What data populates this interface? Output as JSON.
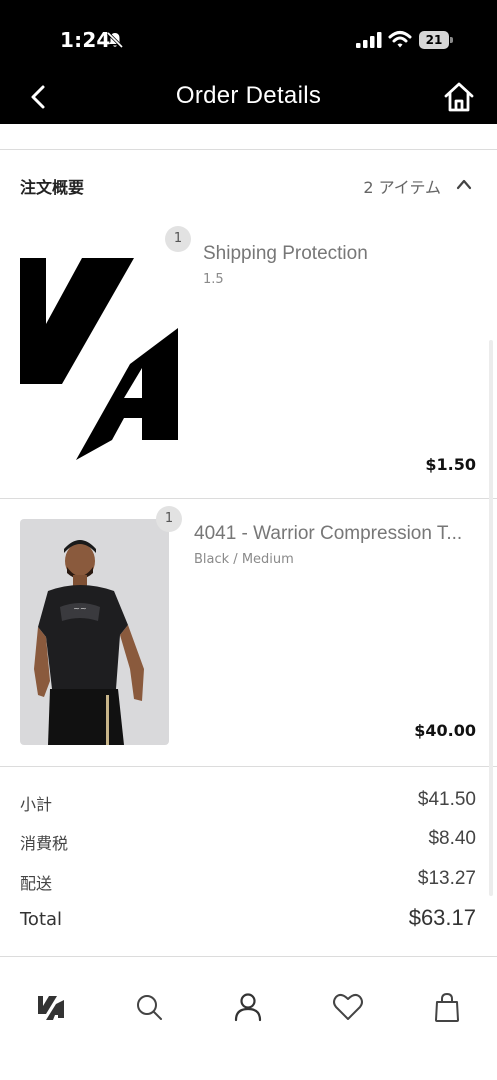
{
  "status_bar": {
    "time": "1:24",
    "battery": "21"
  },
  "header": {
    "title": "Order Details"
  },
  "summary": {
    "label": "注文概要",
    "count": "2 アイテム"
  },
  "items": [
    {
      "quantity": "1",
      "name": "Shipping Protection",
      "variant": "1.5",
      "price": "$1.50",
      "image": "brand-logo"
    },
    {
      "quantity": "1",
      "name": "4041 - Warrior Compression T...",
      "variant": "Black / Medium",
      "price": "$40.00",
      "image": "product-photo-compression-tee"
    }
  ],
  "totals": {
    "subtotal_label": "小計",
    "subtotal_value": "$41.50",
    "tax_label": "消費税",
    "tax_value": "$8.40",
    "shipping_label": "配送",
    "shipping_value": "$13.27",
    "total_label": "Total",
    "total_value": "$63.17"
  },
  "tab_bar": [
    "logo-icon",
    "search-icon",
    "account-icon",
    "heart-icon",
    "bag-icon"
  ],
  "colors": {
    "header_bg": "#000000",
    "text": "#1b1b1b",
    "muted": "#777777",
    "badge_bg": "#e2e2e2"
  }
}
